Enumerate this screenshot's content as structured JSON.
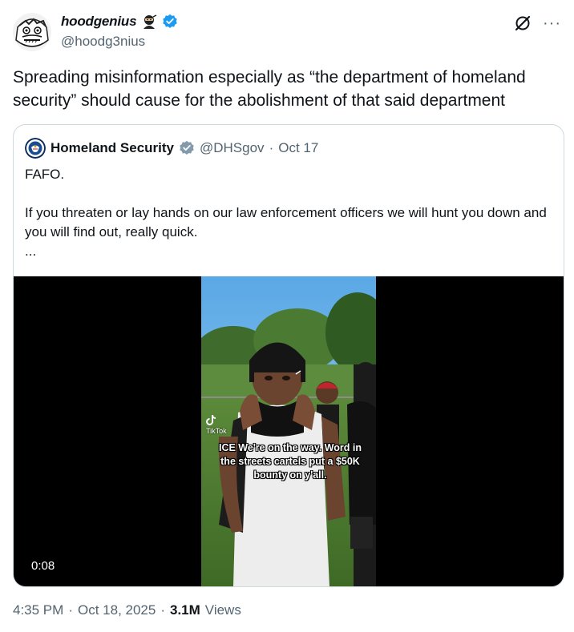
{
  "author": {
    "name": "hoodgenius",
    "handle": "@hoodg3nius",
    "emoji": "ninja-emoji",
    "verified": true,
    "verified_color": "#1d9bf0"
  },
  "tweet": {
    "text": "Spreading misinformation especially as “the department of homeland security” should cause for the abolishment of that said department"
  },
  "header_actions": {
    "grok_icon": "grok-icon",
    "more_label": "···"
  },
  "quote": {
    "name": "Homeland Security",
    "handle": "@DHSgov",
    "separator": "·",
    "date": "Oct 17",
    "badge_color": "#829aab",
    "lines": [
      "FAFO.",
      "If you threaten or lay hands on our law enforcement officers we will hunt you down and you will find out, really quick.",
      "..."
    ]
  },
  "media": {
    "duration": "0:08",
    "watermark": "TikTok",
    "caption": "ICE We're on the way. Word in the streets cartels put a $50K bounty on y'all."
  },
  "footer": {
    "time": "4:35 PM",
    "separator": "·",
    "date": "Oct 18, 2025",
    "separator2": "·",
    "views_count": "3.1M",
    "views_label": "Views"
  }
}
